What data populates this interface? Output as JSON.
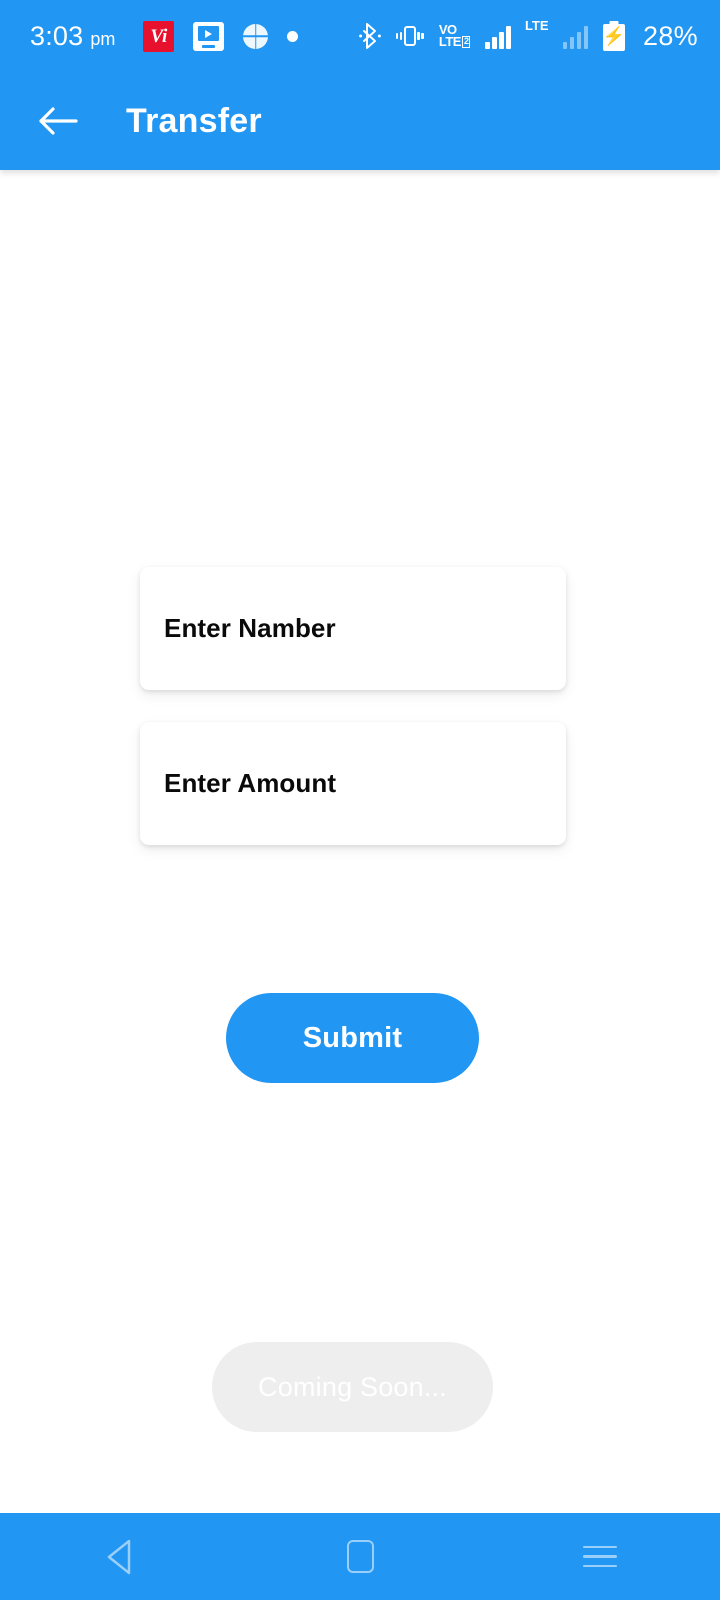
{
  "theme": {
    "accent": "#2196f3",
    "surface": "#ffffff",
    "disabled_surface": "#eeeeee",
    "carrier_logo_color": "#e8112d",
    "text_primary": "#0a0a0a",
    "text_on_accent": "#ffffff"
  },
  "status_bar": {
    "clock": "3:03",
    "am_pm": "pm",
    "notification_icons": [
      {
        "name": "vi-carrier-app-icon",
        "glyph": "Vi"
      },
      {
        "name": "video-player-icon",
        "glyph": "tv-play"
      },
      {
        "name": "globe-browser-icon",
        "glyph": "globe"
      },
      {
        "name": "generic-notification-dot-icon",
        "glyph": "dot"
      }
    ],
    "system_icons": [
      {
        "name": "bluetooth-icon"
      },
      {
        "name": "vibrate-mode-icon"
      },
      {
        "name": "volte-icon"
      },
      {
        "name": "signal-sim1-icon"
      },
      {
        "name": "lte-icon"
      },
      {
        "name": "signal-sim2-icon"
      },
      {
        "name": "battery-charging-icon"
      }
    ],
    "volte": {
      "line1": "VO",
      "line2": "LTE",
      "sim_badge": "2"
    },
    "network_label": "LTE",
    "battery_percent": "28%"
  },
  "app_bar": {
    "back_label": "←",
    "title": "Transfer"
  },
  "form": {
    "fields": [
      {
        "id": "number",
        "label": "Enter Namber",
        "value": "",
        "placeholder": "Enter Namber"
      },
      {
        "id": "amount",
        "label": "Enter Amount",
        "value": "",
        "placeholder": "Enter Amount"
      }
    ],
    "submit_label": "Submit"
  },
  "toast": {
    "message": "Coming Soon..."
  },
  "nav_bar": {
    "buttons": [
      {
        "name": "nav-back-button",
        "label": "Back"
      },
      {
        "name": "nav-home-button",
        "label": "Home"
      },
      {
        "name": "nav-recents-button",
        "label": "Recents"
      }
    ]
  }
}
